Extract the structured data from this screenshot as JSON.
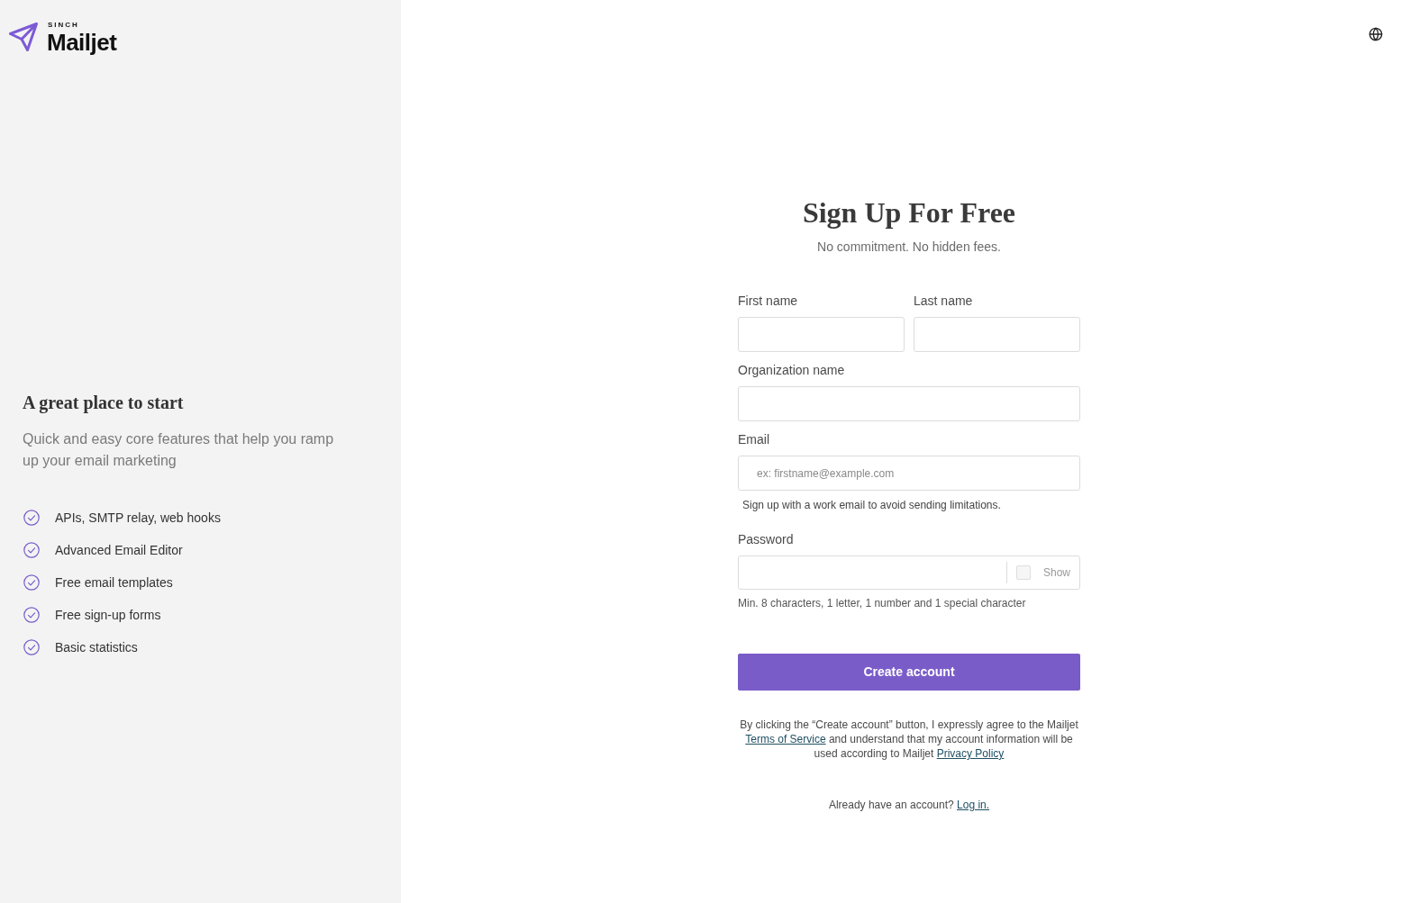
{
  "brand": {
    "tagline": "SINCH",
    "name": "Mailjet"
  },
  "sidebar": {
    "heading": "A great place to start",
    "description": "Quick and easy core features that help you ramp up your email marketing",
    "features": [
      {
        "label": "APIs, SMTP relay, web hooks"
      },
      {
        "label": "Advanced Email Editor"
      },
      {
        "label": "Free email templates"
      },
      {
        "label": "Free sign-up forms"
      },
      {
        "label": "Basic statistics"
      }
    ]
  },
  "form": {
    "title": "Sign Up For Free",
    "subtitle": "No commitment. No hidden fees.",
    "name_fields": [
      {
        "label": "First name"
      },
      {
        "label": "Last name"
      }
    ],
    "organization": {
      "label": "Organization name"
    },
    "email": {
      "label": "Email",
      "placeholder": "ex: firstname@example.com",
      "hint": "Sign up with a work email to avoid sending limitations."
    },
    "password": {
      "label": "Password",
      "show_toggle": {
        "label": "Show",
        "checked": false
      },
      "hint": "Min. 8 characters, 1 letter, 1 number and 1 special character"
    },
    "submit": "Create account",
    "legal": [
      {
        "kind": "text",
        "text": "By clicking the “Create account” button, I expressly agree to the Mailjet "
      },
      {
        "kind": "link",
        "text": "Terms of Service"
      },
      {
        "kind": "text",
        "text": " and understand that my account information will be used according to Mailjet "
      },
      {
        "kind": "link",
        "text": "Privacy Policy"
      }
    ],
    "login": [
      {
        "kind": "text",
        "text": "Already have an account? "
      },
      {
        "kind": "link",
        "text": "Log in."
      }
    ]
  }
}
